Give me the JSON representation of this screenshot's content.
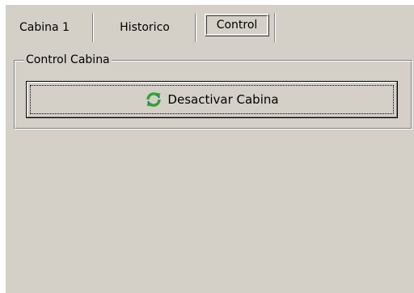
{
  "tabs": [
    {
      "label": "Cabina 1",
      "selected": false
    },
    {
      "label": "Historico",
      "selected": false
    },
    {
      "label": "Control",
      "selected": true
    }
  ],
  "control_panel": {
    "group_title": "Control Cabina",
    "action_button": {
      "label": "Desactivar Cabina",
      "icon": "refresh-icon"
    }
  },
  "colors": {
    "window_background": "#d4d0c8",
    "icon_green": "#2ea42e",
    "icon_blue": "#2050c0"
  }
}
